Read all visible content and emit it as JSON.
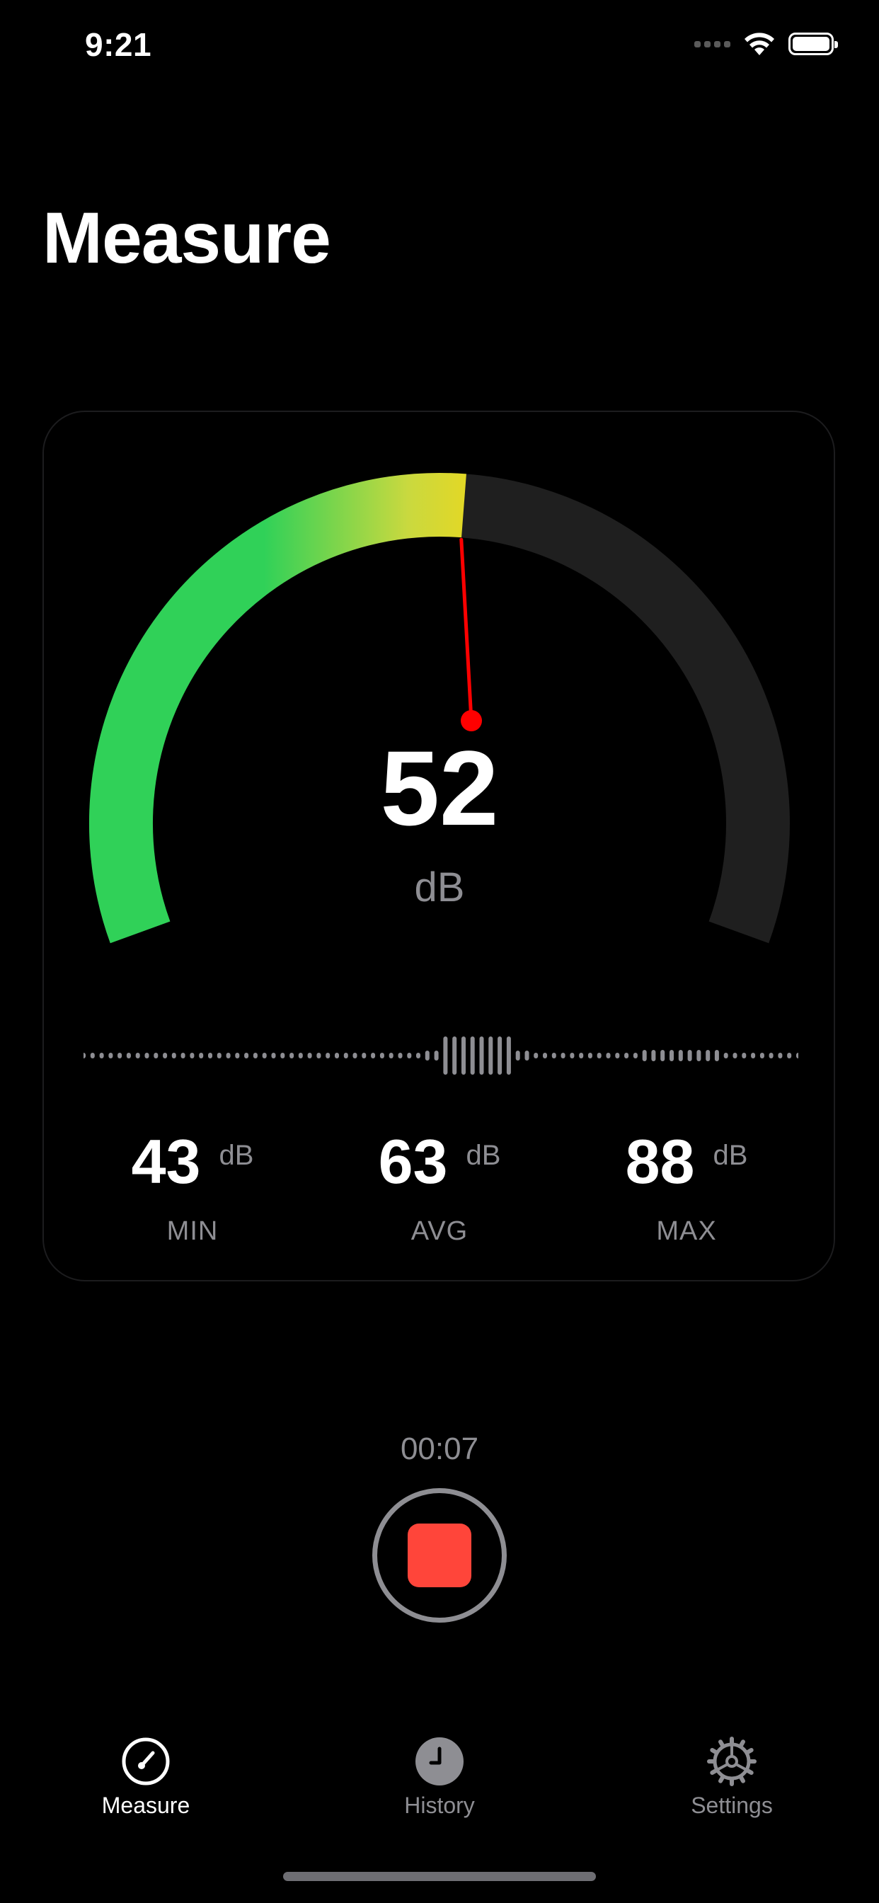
{
  "status_bar": {
    "time": "9:21"
  },
  "header": {
    "title": "Measure"
  },
  "meter": {
    "value": "52",
    "unit": "dB",
    "level_fraction": 0.52,
    "colors": {
      "low": "#30d158",
      "mid": "#9bd94a",
      "high": "#ffd60a",
      "track": "#1f1f1f",
      "needle": "#ff0000"
    }
  },
  "stats": [
    {
      "value": "43",
      "unit": "dB",
      "label": "MIN"
    },
    {
      "value": "63",
      "unit": "dB",
      "label": "AVG"
    },
    {
      "value": "88",
      "unit": "dB",
      "label": "MAX"
    }
  ],
  "recording": {
    "elapsed": "00:07",
    "stop_color": "#ff453a"
  },
  "tab_bar": {
    "tabs": [
      {
        "label": "Measure",
        "icon": "gauge-icon",
        "active": true
      },
      {
        "label": "History",
        "icon": "clock-icon",
        "active": false
      },
      {
        "label": "Settings",
        "icon": "gear-icon",
        "active": false
      }
    ]
  }
}
